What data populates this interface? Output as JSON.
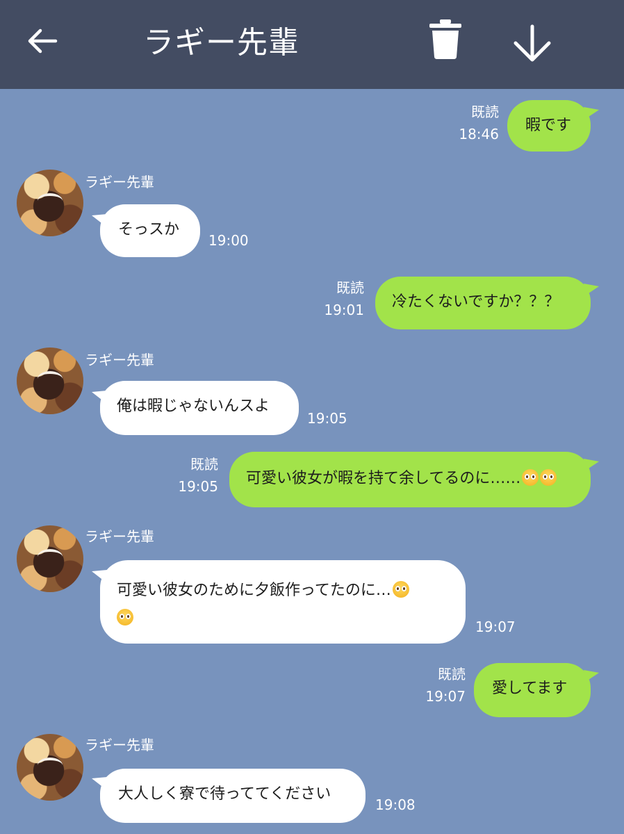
{
  "header": {
    "title": "ラギー先輩",
    "background": "#434c62"
  },
  "icons": {
    "back": "arrow-left-icon",
    "trash": "trash-icon",
    "download": "arrow-down-icon",
    "emoji": "pleading-face-icon"
  },
  "colors": {
    "chat_background": "#7893bd",
    "my_bubble": "#a2e34a",
    "their_bubble": "#ffffff"
  },
  "messages": [
    {
      "from": "me",
      "text": "暇です",
      "read": "既読",
      "time": "18:46"
    },
    {
      "from": "them",
      "sender": "ラギー先輩",
      "text": "そっスか",
      "time": "19:00"
    },
    {
      "from": "me",
      "text": "冷たくないですか？？？",
      "read": "既読",
      "time": "19:01"
    },
    {
      "from": "them",
      "sender": "ラギー先輩",
      "text": "俺は暇じゃないんスよ",
      "time": "19:05"
    },
    {
      "from": "me",
      "text": "可愛い彼女が暇を持て余してるのに……",
      "read": "既読",
      "time": "19:05"
    },
    {
      "from": "them",
      "sender": "ラギー先輩",
      "text": "可愛い彼女のために夕飯作ってたのに…",
      "time": "19:07"
    },
    {
      "from": "me",
      "text": "愛してます",
      "read": "既読",
      "time": "19:07"
    },
    {
      "from": "them",
      "sender": "ラギー先輩",
      "text": "大人しく寮で待っててください",
      "time": "19:08"
    }
  ]
}
